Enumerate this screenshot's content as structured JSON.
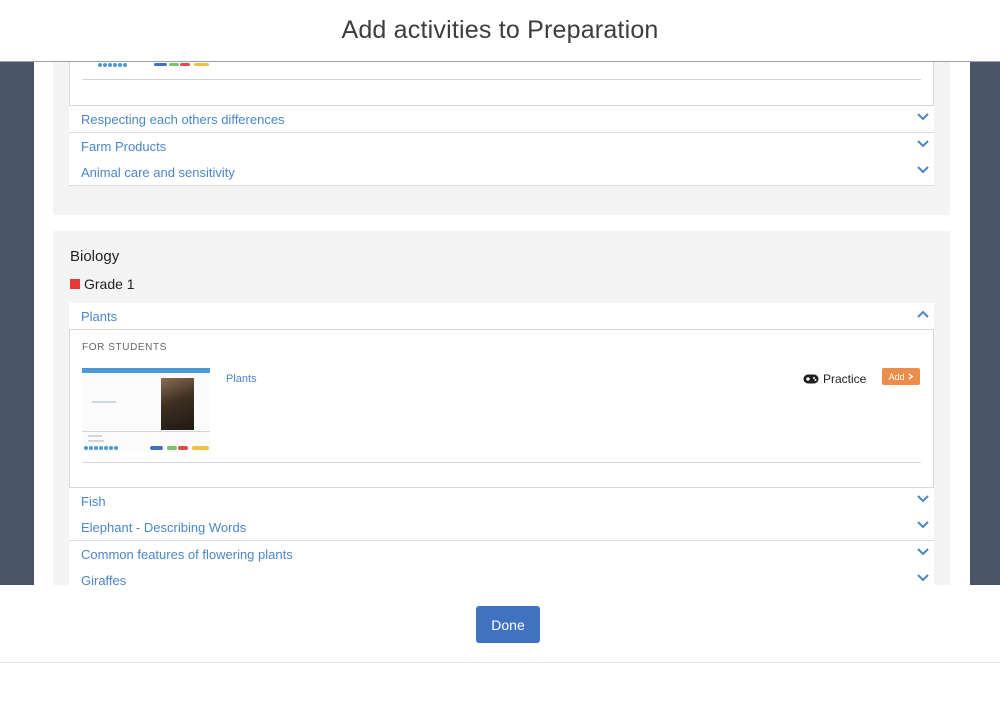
{
  "modal": {
    "title": "Add activities to Preparation"
  },
  "top_section": {
    "rows": [
      {
        "label": "Respecting each others differences",
        "expanded": false
      },
      {
        "label": "Farm Products",
        "expanded": false
      },
      {
        "label": "Animal care and sensitivity",
        "expanded": false
      }
    ]
  },
  "biology_section": {
    "title": "Biology",
    "grade": {
      "label": "Grade 1",
      "color": "#e53935"
    },
    "expanded_row": {
      "label": "Plants",
      "expanded": true,
      "audience_label": "FOR STUDENTS",
      "activity": {
        "title": "Plants",
        "mode_label": "Practice",
        "mode_icon": "gamepad-icon",
        "add_label": "Add"
      }
    },
    "rows": [
      {
        "label": "Fish",
        "expanded": false
      },
      {
        "label": "Elephant - Describing Words",
        "expanded": false
      },
      {
        "label": "Common features of flowering plants",
        "expanded": false
      },
      {
        "label": "Giraffes",
        "expanded": false
      }
    ]
  },
  "footer": {
    "done_label": "Done"
  },
  "colors": {
    "accent": "#3f72bf",
    "link": "#4a86c8",
    "add_button": "#ec8d4c",
    "backdrop": "#4a5568"
  }
}
